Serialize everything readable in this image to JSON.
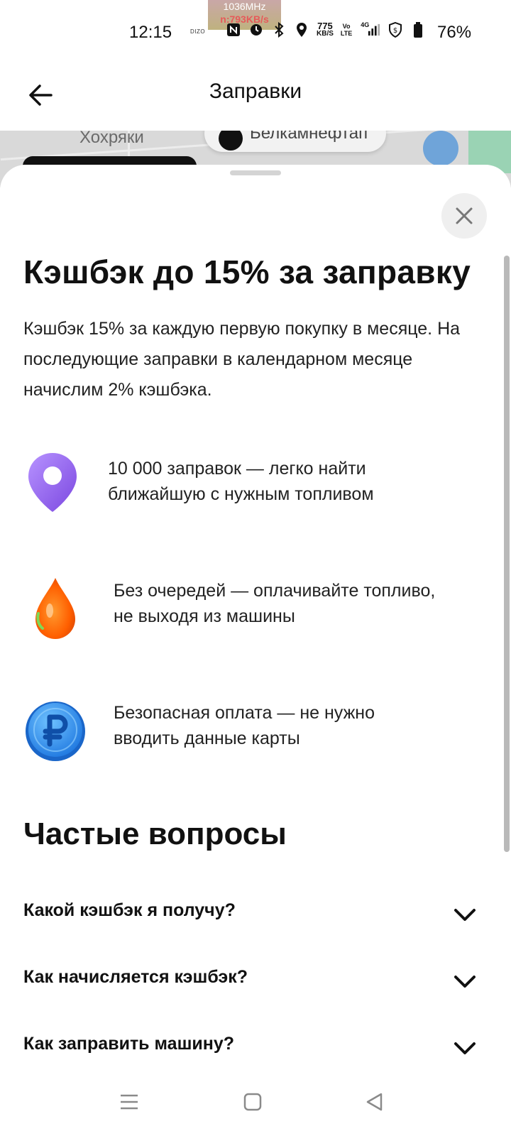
{
  "status_bar": {
    "time": "12:15",
    "brand": "DIZO",
    "overlay_line1": "1036MHz",
    "overlay_line2": "n:793KB/s",
    "net_speed_value": "775",
    "net_speed_unit": "KB/S",
    "volte_top": "Vo",
    "volte_bottom": "LTE",
    "network": "4G",
    "battery": "76%",
    "icons": [
      "nfc-icon",
      "alarm-icon",
      "bluetooth-icon",
      "location-icon",
      "signal-icon",
      "shield-icon",
      "battery-icon"
    ]
  },
  "header": {
    "title": "Заправки",
    "back_icon": "arrow-left-icon"
  },
  "map": {
    "place_label": "Хохряки",
    "chip_label": "Белкамнефтап"
  },
  "sheet": {
    "close_icon": "close-icon",
    "title": "Кэшбэк до 15% за заправку",
    "description": "Кэшбэк 15% за каждую первую покупку в месяце. На последующие заправки в календарном месяце начислим 2% кэшбэка.",
    "features": [
      {
        "icon": "location-pin-icon",
        "line1": "10 000 заправок — легко найти",
        "line2": "ближайшую с нужным топливом"
      },
      {
        "icon": "fuel-drop-icon",
        "line1": "Без очередей — оплачивайте топливо,",
        "line2": "не выходя из машины"
      },
      {
        "icon": "ruble-coin-icon",
        "line1": "Безопасная оплата — не нужно",
        "line2": "вводить данные карты"
      }
    ],
    "faq_title": "Частые вопросы",
    "faq": [
      {
        "question": "Какой кэшбэк я получу?"
      },
      {
        "question": "Как начисляется кэшбэк?"
      },
      {
        "question": "Как заправить машину?"
      }
    ]
  },
  "nav_bar": {
    "icons": [
      "menu-icon",
      "home-icon",
      "back-triangle-icon"
    ]
  },
  "colors": {
    "pin": "#9b6cf2",
    "drop": "#ff6a00",
    "coin": "#2e8ff0",
    "scrollbar": "#b9b9b9"
  }
}
